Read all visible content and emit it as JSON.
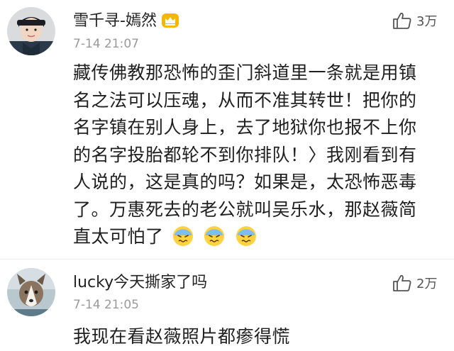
{
  "comments": [
    {
      "username": "雪千寻-嫣然",
      "timestamp": "7-14 21:07",
      "likes": "3万",
      "text_lines": [
        "藏传佛教那恐怖的歪门斜道里一条就是用镇",
        "名之法可以压魂，从而不准其转世！把你的",
        "名字镇在别人身上，去了地狱你也报不上你",
        "的名字投胎都轮不到你排队！〉我刚看到有",
        "人说的，这是真的吗？如果是，太恐怖恶毒",
        "了。万惠死去的老公就叫吴乐水，那赵薇简",
        "直太可怕了"
      ],
      "badge_icon": "crown-badge-icon",
      "emoji_icon": "cold-sweat-face-icon",
      "emoji_count": 3
    },
    {
      "username": "lucky今天撕家了吗",
      "timestamp": "7-14 21:05",
      "likes": "2万",
      "text_lines": [
        "我现在看赵薇照片都瘆得慌"
      ]
    }
  ],
  "colors": {
    "text": "#1f1f1f",
    "meta": "#9a9a9a",
    "badge": "#f5b800"
  }
}
